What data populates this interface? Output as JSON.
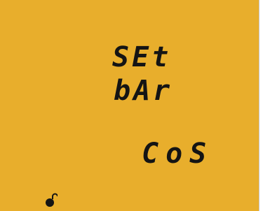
{
  "display": {
    "line1": "SEt",
    "line2": "bAr",
    "line3": "CoS",
    "icon": "unlocked-padlock-icon",
    "background_color": "#e8ae2c",
    "segment_color": "#141414"
  }
}
